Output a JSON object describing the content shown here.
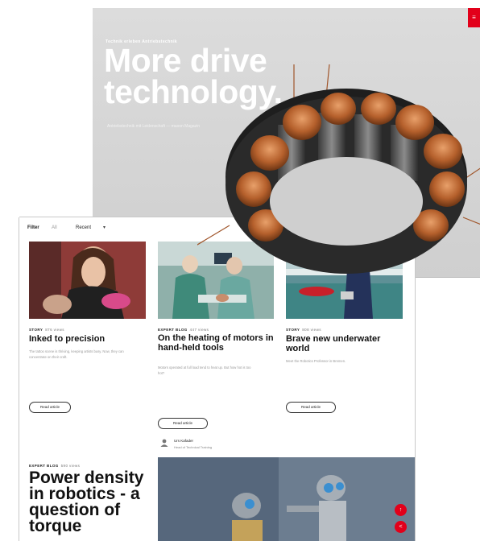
{
  "hero": {
    "kicker": "Technik erleben   Antriebstechnik",
    "headline_line1": "More drive",
    "headline_line2": "technology.",
    "subtitle": "Antriebstechnik mit Leidenschaft — maxon Magazin",
    "menu_icon": "menu-icon"
  },
  "toolbar": {
    "filter_label": "Filter",
    "filter_value": "All",
    "sort_value": "Recent",
    "search_icon": "search-icon",
    "menu_icon": "menu-icon",
    "accent": "#e2001a"
  },
  "articles": [
    {
      "type": "STORY",
      "views": "876 views",
      "title": "Inked to precision",
      "excerpt": "The tattoo scene is thriving, keeping artists busy. Now, they can concentrate on their craft.",
      "button": "Read article"
    },
    {
      "type": "EXPERT BLOG",
      "views": "447 views",
      "title": "On the heating of motors in hand-held tools",
      "excerpt": "Motors operated at full load tend to heat up. But how hot is too hot?",
      "button": "Read article",
      "author_name": "Urs Kafader",
      "author_role": "Head of Technical Training"
    },
    {
      "type": "STORY",
      "views": "808 views",
      "title": "Brave new underwater world",
      "excerpt": "Meet the Robotics Professor in Bremen.",
      "button": "Read article"
    },
    {
      "type": "EXPERT BLOG",
      "views": "590 views",
      "title": "Power density in robotics - a question of torque"
    }
  ],
  "fab": {
    "top_icon": "arrow-up-icon",
    "top_glyph": "↑",
    "share_icon": "share-icon",
    "share_glyph": "<"
  }
}
